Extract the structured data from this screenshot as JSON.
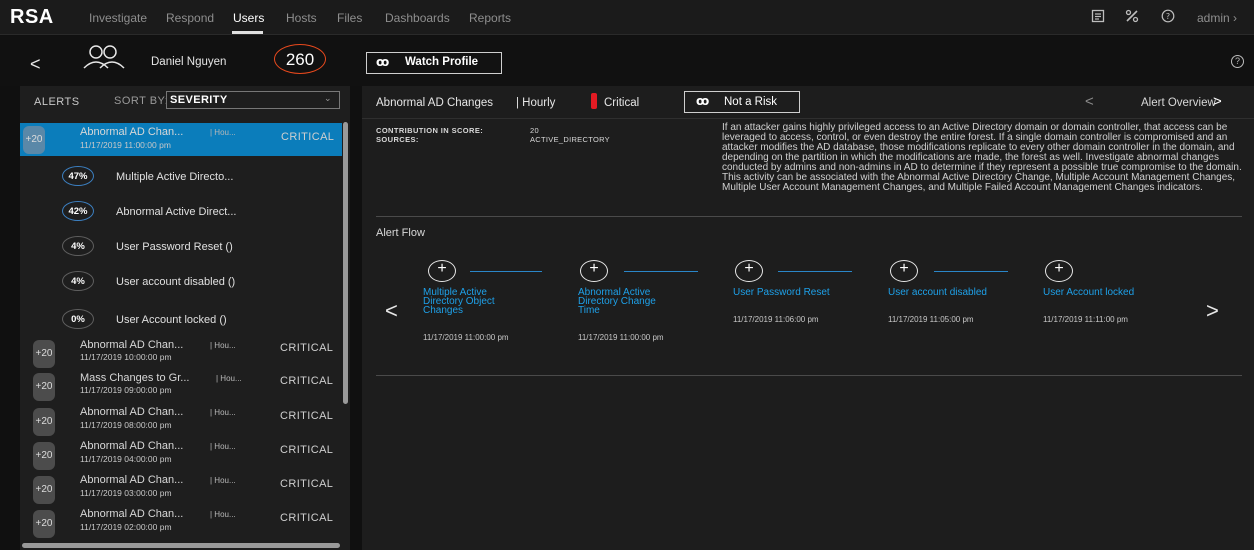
{
  "nav": {
    "logo": "RSA",
    "items": [
      "Investigate",
      "Respond",
      "Users",
      "Hosts",
      "Files",
      "Dashboards",
      "Reports"
    ],
    "active": "Users",
    "user": "admin"
  },
  "profile": {
    "name": "Daniel Nguyen",
    "score": "260",
    "watch_label": "Watch Profile",
    "help": "?"
  },
  "alerts_panel": {
    "title": "ALERTS",
    "sort_label": "SORT BY:",
    "sort_value": "SEVERITY",
    "alerts": [
      {
        "badge": "+20",
        "name": "Abnormal AD Chan...",
        "period": "| Hou...",
        "date": "11/17/2019 11:00:00 pm",
        "severity": "CRITICAL"
      },
      {
        "badge": "+20",
        "name": "Abnormal AD Chan...",
        "period": "| Hou...",
        "date": "11/17/2019 10:00:00 pm",
        "severity": "CRITICAL"
      },
      {
        "badge": "+20",
        "name": "Mass Changes to Gr...",
        "period": "| Hou...",
        "date": "11/17/2019 09:00:00 pm",
        "severity": "CRITICAL"
      },
      {
        "badge": "+20",
        "name": "Abnormal AD Chan...",
        "period": "| Hou...",
        "date": "11/17/2019 08:00:00 pm",
        "severity": "CRITICAL"
      },
      {
        "badge": "+20",
        "name": "Abnormal AD Chan...",
        "period": "| Hou...",
        "date": "11/17/2019 04:00:00 pm",
        "severity": "CRITICAL"
      },
      {
        "badge": "+20",
        "name": "Abnormal AD Chan...",
        "period": "| Hou...",
        "date": "11/17/2019 03:00:00 pm",
        "severity": "CRITICAL"
      },
      {
        "badge": "+20",
        "name": "Abnormal AD Chan...",
        "period": "| Hou...",
        "date": "11/17/2019 02:00:00 pm",
        "severity": "CRITICAL"
      }
    ],
    "indicators": [
      {
        "pct": "47%",
        "label": "Multiple Active Directo..."
      },
      {
        "pct": "42%",
        "label": "Abnormal Active Direct..."
      },
      {
        "pct": "4%",
        "label": "User Password Reset ()"
      },
      {
        "pct": "4%",
        "label": "User account disabled ()"
      },
      {
        "pct": "0%",
        "label": "User Account locked ()"
      }
    ]
  },
  "detail": {
    "alert_name": "Abnormal AD Changes",
    "period": "| Hourly",
    "severity": "Critical",
    "not_risk_label": "Not a Risk",
    "overview_label": "Alert Overview",
    "contribution_key": "CONTRIBUTION IN SCORE:",
    "contribution_val": "20",
    "sources_key": "SOURCES:",
    "sources_val": "ACTIVE_DIRECTORY",
    "description": "If an attacker gains highly privileged access to an Active Directory domain or domain controller, that access can be leveraged to access, control, or even destroy the entire forest. If a single domain controller is compromised and an attacker modifies the AD database, those modifications replicate to every other domain controller in the domain, and depending on the partition in which the modifications are made, the forest as well. Investigate abnormal changes conducted by admins and non-admins in AD to determine if they represent a possible true compromise to the domain. This activity can be associated with the Abnormal Active Directory Change, Multiple Account Management Changes, Multiple User Account Management Changes, and Multiple Failed Account Management Changes indicators.",
    "flow_title": "Alert Flow",
    "flow": [
      {
        "label": "Multiple Active Directory Object Changes",
        "time": "11/17/2019 11:00:00 pm"
      },
      {
        "label": "Abnormal Active Directory Change Time",
        "time": "11/17/2019 11:00:00 pm"
      },
      {
        "label": "User Password Reset",
        "time": "11/17/2019 11:06:00 pm"
      },
      {
        "label": "User account disabled",
        "time": "11/17/2019 11:05:00 pm"
      },
      {
        "label": "User Account locked",
        "time": "11/17/2019 11:11:00 pm"
      }
    ]
  },
  "colors": {
    "accent": "#0b7dbb",
    "critical": "#e31b23",
    "score_ring": "#e8491d",
    "link": "#1ea0e8"
  }
}
